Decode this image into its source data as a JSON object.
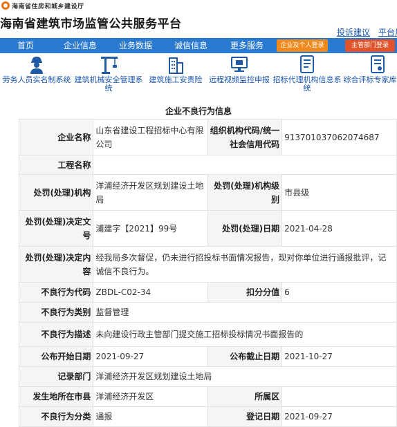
{
  "header": {
    "logo_text": "海南省住房和城乡建设厅",
    "site_title": "海南省建筑市场监管公共服务平台",
    "links": [
      "投诉建议",
      "平台用户"
    ]
  },
  "nav": {
    "items": [
      "首页",
      "企业信息",
      "业务数据",
      "诚信信息",
      "更多服务"
    ],
    "login_buttons": [
      "企业及个人登录",
      "主管部门登录"
    ]
  },
  "icon_bar": [
    {
      "icon": "worker-icon",
      "label": "劳务人员实名制系统"
    },
    {
      "icon": "crane-icon",
      "label": "建筑机械安全管理系统"
    },
    {
      "icon": "building-icon",
      "label": "建筑施工安责险"
    },
    {
      "icon": "monitor-icon",
      "label": "远程视频监控申报"
    },
    {
      "icon": "document-icon",
      "label": "招标代理机构信息系统"
    },
    {
      "icon": "report-icon",
      "label": "综合评标专家库系统"
    }
  ],
  "section_title": "企业不良行为信息",
  "record": {
    "company_name_label": "企业名称",
    "company_name": "山东省建设工程招标中心有限公司",
    "org_code_label": "组织机构代码/统一社会信用代码",
    "org_code": "913701037062074687",
    "project_name_label": "工程名称",
    "project_name": "",
    "authority_label": "处罚(处理)机构",
    "authority": "洋浦经济开发区规划建设土地局",
    "authority_level_label": "处罚(处理)机构级别",
    "authority_level": "市县级",
    "decision_no_label": "处罚(处理)决定文号",
    "decision_no": "浦建字【2021】99号",
    "decision_date_label": "处罚(处理)日期",
    "decision_date": "2021-04-28",
    "decision_content_label": "处罚(处理)决定内容",
    "decision_content": "经我局多次督促，仍未进行招投标书面情况报告，现对你单位进行通报批评，记诚信不良行为。",
    "behavior_code_label": "不良行为代码",
    "behavior_code": "ZBDL-C02-34",
    "deduct_label": "扣分分值",
    "deduct": "6",
    "behavior_type_label": "不良行为类别",
    "behavior_type": "监督管理",
    "behavior_desc_label": "不良行为描述",
    "behavior_desc": "未向建设行政主管部门提交施工招标投标情况书面报告的",
    "publish_start_label": "公布开始日期",
    "publish_start": "2021-09-27",
    "publish_end_label": "公布截止日期",
    "publish_end": "2021-10-27",
    "record_dept_label": "记录部门",
    "record_dept": "洋浦经济开发区规划建设土地局",
    "city_label": "发生地所在市县",
    "city": "洋浦经济开发区",
    "district_label": "所属区",
    "district": "",
    "category_label": "不良行为分类",
    "category": "通报",
    "register_date_label": "登记日期",
    "register_date": "2021-09-27"
  }
}
